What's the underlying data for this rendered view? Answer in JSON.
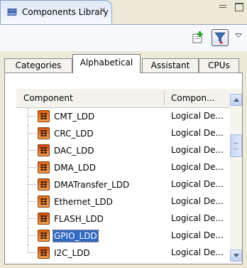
{
  "view": {
    "title": "Components Library",
    "close_glyph": "✕"
  },
  "toolbar": {
    "new_icon": "new-component-icon",
    "filter_icon": "filter-icon",
    "menu_icon": "view-menu-chevron-icon"
  },
  "tabs": [
    {
      "label": "Categories",
      "active": false
    },
    {
      "label": "Alphabetical",
      "active": true
    },
    {
      "label": "Assistant",
      "active": false
    },
    {
      "label": "CPUs",
      "active": false
    }
  ],
  "table": {
    "columns": [
      "Component",
      "Compon..."
    ],
    "rows": [
      {
        "name": "CMT_LDD",
        "type": "Logical De...",
        "icon": "cmt-icon",
        "color": "#e06010",
        "selected": false
      },
      {
        "name": "CRC_LDD",
        "type": "Logical De...",
        "icon": "crc-icon",
        "color": "#d05818",
        "selected": false
      },
      {
        "name": "DAC_LDD",
        "type": "Logical De...",
        "icon": "dac-icon",
        "color": "#d04010",
        "selected": false
      },
      {
        "name": "DMA_LDD",
        "type": "Logical De...",
        "icon": "dma-icon",
        "color": "#e06818",
        "selected": false
      },
      {
        "name": "DMATransfer_LDD",
        "type": "Logical De...",
        "icon": "dma-transfer-icon",
        "color": "#d86018",
        "selected": false
      },
      {
        "name": "Ethernet_LDD",
        "type": "Logical De...",
        "icon": "ethernet-icon",
        "color": "#e07020",
        "selected": false
      },
      {
        "name": "FLASH_LDD",
        "type": "Logical De...",
        "icon": "flash-icon",
        "color": "#c85010",
        "selected": false
      },
      {
        "name": "GPIO_LDD",
        "type": "Logical De...",
        "icon": "gpio-icon",
        "color": "#d86010",
        "selected": true
      },
      {
        "name": "I2C_LDD",
        "type": "Logical De...",
        "icon": "i2c-icon",
        "color": "#d05010",
        "selected": false
      }
    ]
  }
}
